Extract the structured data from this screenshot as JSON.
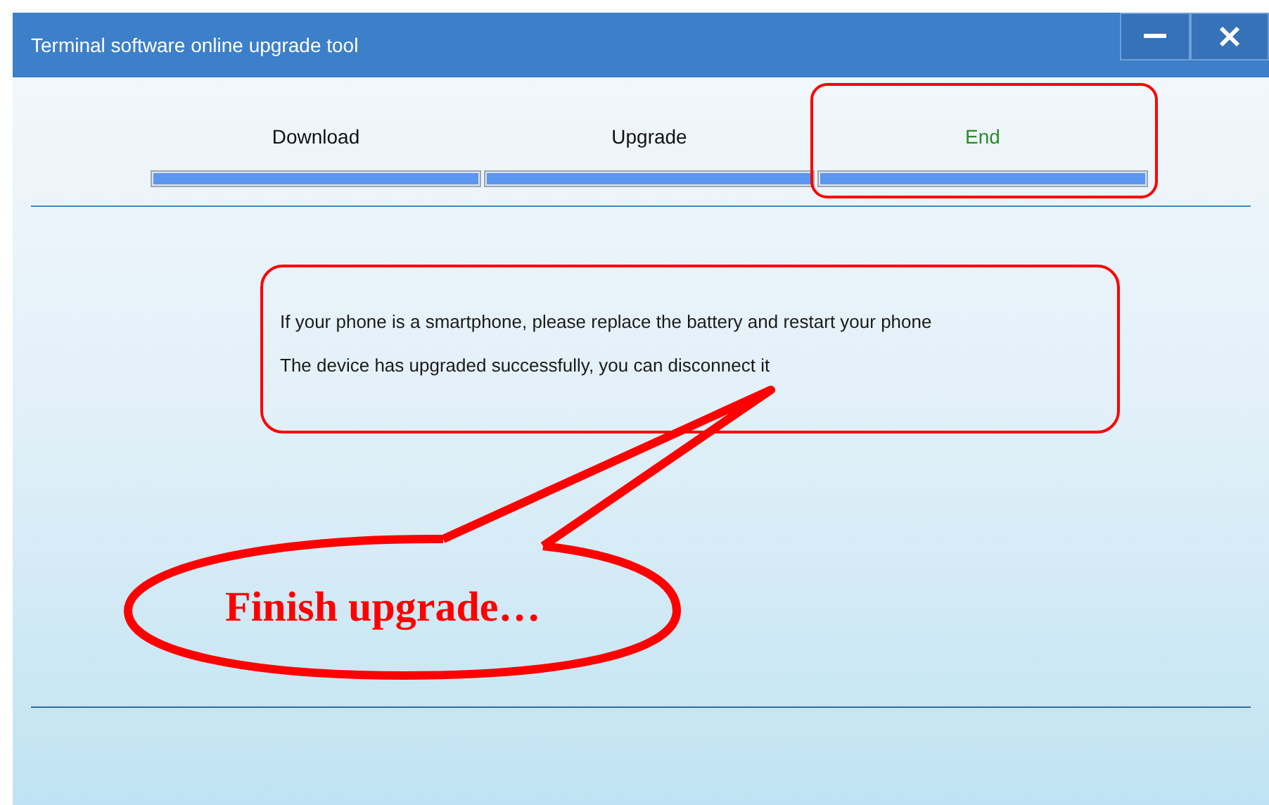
{
  "window": {
    "title": "Terminal software online upgrade tool"
  },
  "steps": [
    {
      "label": "Download",
      "selected": false,
      "level": 1,
      "highlighted": false
    },
    {
      "label": "Upgrade",
      "selected": false,
      "level": 1,
      "highlighted": false
    },
    {
      "label": "End",
      "selected": true,
      "level": 1,
      "highlighted": true
    }
  ],
  "message_box": {
    "highlighted": true,
    "lines": [
      "If your phone is a smartphone, please replace the battery and restart your phone",
      "The device has upgraded successfully, you can disconnect it"
    ]
  },
  "callout": {
    "text": "Finish upgrade…"
  }
}
